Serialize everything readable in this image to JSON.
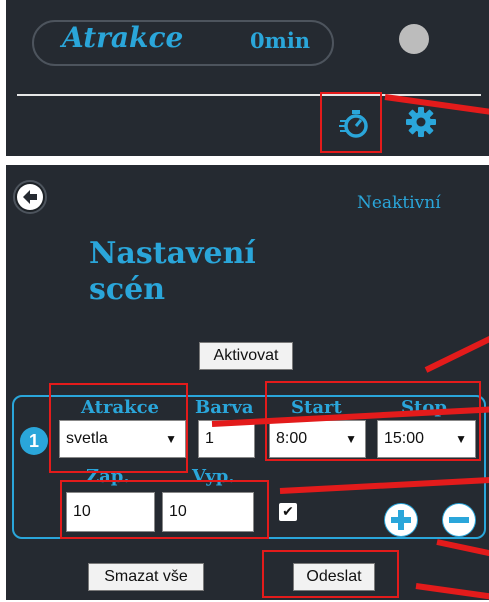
{
  "top_panel": {
    "title": "Atrakce",
    "time": "0min",
    "icons": [
      "timer-icon",
      "gear-icon"
    ]
  },
  "settings": {
    "status": "Neaktivní",
    "heading": "Nastavení scén",
    "activate_label": "Aktivovat",
    "row": {
      "number": "1",
      "labels": {
        "attraction": "Atrakce",
        "color": "Barva",
        "start": "Start",
        "stop": "Stop",
        "on": "Zap.",
        "off": "Vyp."
      },
      "attraction_value": "svetla",
      "color_value": "1",
      "start_value": "8:00",
      "stop_value": "15:00",
      "on_value": "10",
      "off_value": "10",
      "checked": true
    },
    "clear_all_label": "Smazat vše",
    "send_label": "Odeslat"
  },
  "colors": {
    "accent": "#2aa6da",
    "panel": "#252a31",
    "annotation": "#e31b1b"
  }
}
